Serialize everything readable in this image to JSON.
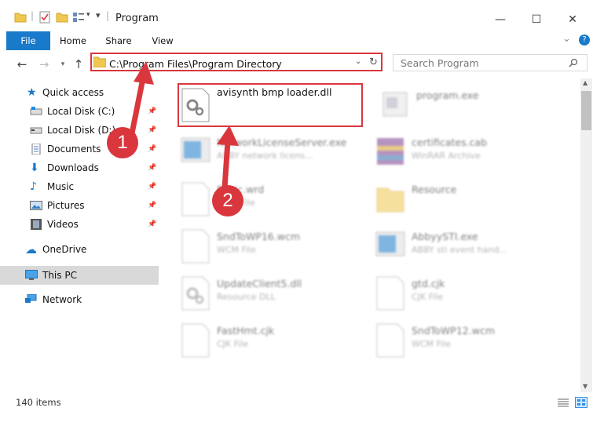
{
  "window": {
    "title": "Program",
    "minimize_glyph": "—",
    "maximize_glyph": "☐",
    "close_glyph": "✕"
  },
  "ribbon": {
    "tabs": [
      "File",
      "Home",
      "Share",
      "View"
    ],
    "help_glyph": "?",
    "expand_glyph": "⌄"
  },
  "nav": {
    "address": "C:\\Program Files\\Program Directory",
    "search_placeholder": "Search Program"
  },
  "sidebar": {
    "items": [
      {
        "label": "Quick access",
        "icon": "star-icon"
      },
      {
        "label": "Local Disk (C:)",
        "icon": "drive-icon"
      },
      {
        "label": "Local Disk (D:)",
        "icon": "drive-icon"
      },
      {
        "label": "Documents",
        "icon": "documents-icon"
      },
      {
        "label": "Downloads",
        "icon": "download-icon"
      },
      {
        "label": "Music",
        "icon": "music-icon"
      },
      {
        "label": "Pictures",
        "icon": "pictures-icon"
      },
      {
        "label": "Videos",
        "icon": "videos-icon"
      },
      {
        "label": "OneDrive",
        "icon": "cloud-icon"
      },
      {
        "label": "This PC",
        "icon": "computer-icon"
      },
      {
        "label": "Network",
        "icon": "network-icon"
      }
    ]
  },
  "files": [
    {
      "name": "avisynth bmp loader.dll",
      "type": ""
    },
    {
      "name": "program.exe",
      "type": ""
    },
    {
      "name": "NetworkLicenseServer.exe",
      "type": "ABBY network licens..."
    },
    {
      "name": "certificates.cab",
      "type": "WinRAR Archive"
    },
    {
      "name": "Basic.wrd",
      "type": "WRD File"
    },
    {
      "name": "Resource",
      "type": ""
    },
    {
      "name": "SndToWP16.wcm",
      "type": "WCM File"
    },
    {
      "name": "AbbyySTI.exe",
      "type": "ABBY sti event hand..."
    },
    {
      "name": "UpdateClient5.dll",
      "type": "Resource DLL"
    },
    {
      "name": "gtd.cjk",
      "type": "CJK File"
    },
    {
      "name": "FastHmt.cjk",
      "type": "CJK File"
    },
    {
      "name": "SndToWP12.wcm",
      "type": "WCM File"
    }
  ],
  "status": {
    "count": "140 items"
  },
  "annotations": {
    "step1": "1",
    "step2": "2"
  },
  "colors": {
    "accent": "#1979ca",
    "highlight": "#d9373d",
    "selected": "#d9d9d9"
  }
}
